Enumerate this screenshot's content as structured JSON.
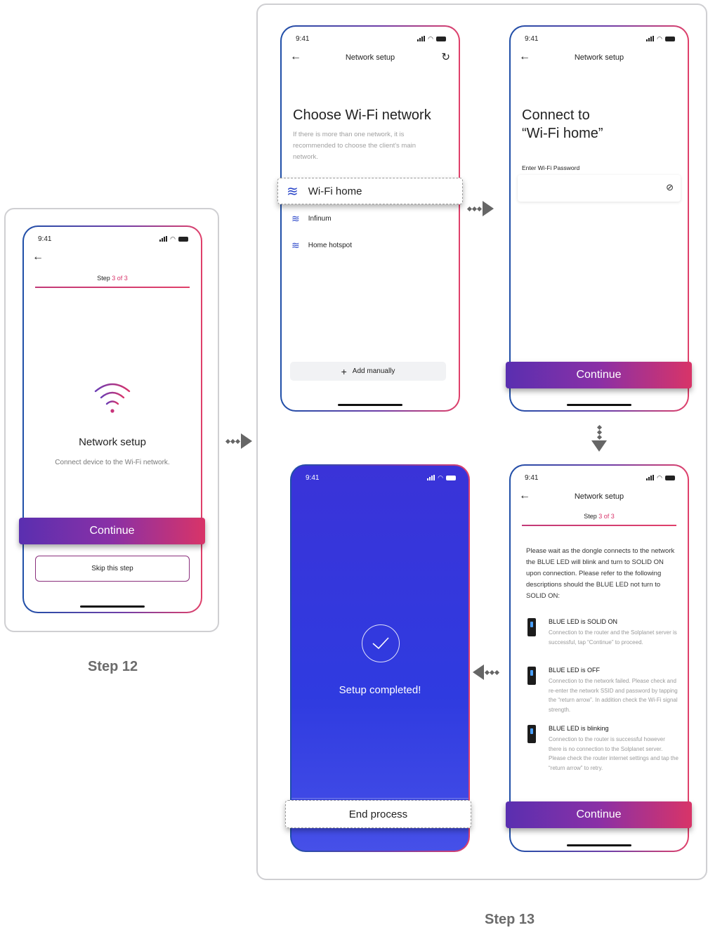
{
  "status_time": "9:41",
  "captions": {
    "step12": "Step 12",
    "step13": "Step 13"
  },
  "colors": {
    "accent_pink": "#d8336a",
    "accent_purple": "#5a2fb0",
    "blue_screen": "#3a33d8",
    "wifi_blue": "#2a46c9"
  },
  "screen_intro": {
    "step_prefix": "Step ",
    "step_current": "3 of 3",
    "title": "Network setup",
    "subtitle": "Connect device to the Wi-Fi network.",
    "continue_label": "Continue",
    "skip_label": "Skip this step"
  },
  "screen_choose": {
    "header": "Network setup",
    "title": "Choose Wi-Fi network",
    "description": "If there is more than one network, it is recommended to choose the client's main network.",
    "networks": [
      "Wi-Fi home",
      "Infinum",
      "Home hotspot"
    ],
    "add_manually": "Add manually"
  },
  "screen_connect": {
    "header": "Network setup",
    "title_line1": "Connect to",
    "title_line2": "“Wi-Fi home”",
    "password_label": "Enter Wi-Fi Password",
    "continue_label": "Continue"
  },
  "screen_wait": {
    "header": "Network setup",
    "step_prefix": "Step ",
    "step_current": "3 of 3",
    "intro": "Please wait as the dongle connects to the network the BLUE LED will blink and turn to SOLID ON upon connection. Please refer to the following descriptions should the BLUE LED not turn to SOLID ON:",
    "leds": [
      {
        "title": "BLUE LED is SOLID ON",
        "desc": "Connection to the router and the Solplanet server is successful, tap “Continue” to proceed."
      },
      {
        "title": "BLUE LED is OFF",
        "desc": "Connection to the network failed. Please check and re-enter the network SSID and password by tapping the “return arrow”. In addition check the Wi-Fi signal strength."
      },
      {
        "title": "BLUE LED is blinking",
        "desc": "Connection to the router is successful however there is no connection to the Solplanet server. Please check the router internet settings and tap the “return arrow” to retry."
      }
    ],
    "continue_label": "Continue"
  },
  "screen_done": {
    "message": "Setup completed!",
    "end_label": "End process"
  }
}
